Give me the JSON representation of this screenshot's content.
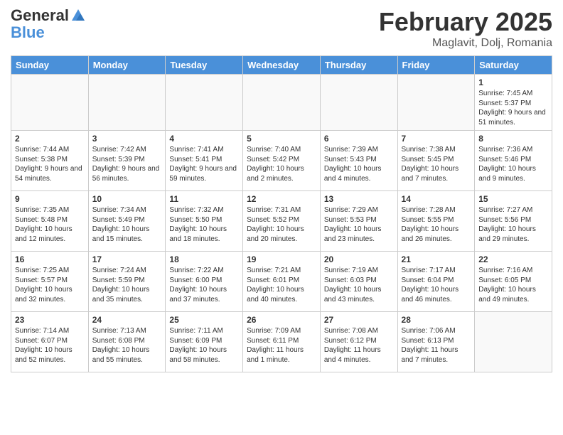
{
  "header": {
    "logo_general": "General",
    "logo_blue": "Blue",
    "month_title": "February 2025",
    "location": "Maglavit, Dolj, Romania"
  },
  "days_of_week": [
    "Sunday",
    "Monday",
    "Tuesday",
    "Wednesday",
    "Thursday",
    "Friday",
    "Saturday"
  ],
  "weeks": [
    [
      {
        "day": "",
        "info": ""
      },
      {
        "day": "",
        "info": ""
      },
      {
        "day": "",
        "info": ""
      },
      {
        "day": "",
        "info": ""
      },
      {
        "day": "",
        "info": ""
      },
      {
        "day": "",
        "info": ""
      },
      {
        "day": "1",
        "info": "Sunrise: 7:45 AM\nSunset: 5:37 PM\nDaylight: 9 hours and 51 minutes."
      }
    ],
    [
      {
        "day": "2",
        "info": "Sunrise: 7:44 AM\nSunset: 5:38 PM\nDaylight: 9 hours and 54 minutes."
      },
      {
        "day": "3",
        "info": "Sunrise: 7:42 AM\nSunset: 5:39 PM\nDaylight: 9 hours and 56 minutes."
      },
      {
        "day": "4",
        "info": "Sunrise: 7:41 AM\nSunset: 5:41 PM\nDaylight: 9 hours and 59 minutes."
      },
      {
        "day": "5",
        "info": "Sunrise: 7:40 AM\nSunset: 5:42 PM\nDaylight: 10 hours and 2 minutes."
      },
      {
        "day": "6",
        "info": "Sunrise: 7:39 AM\nSunset: 5:43 PM\nDaylight: 10 hours and 4 minutes."
      },
      {
        "day": "7",
        "info": "Sunrise: 7:38 AM\nSunset: 5:45 PM\nDaylight: 10 hours and 7 minutes."
      },
      {
        "day": "8",
        "info": "Sunrise: 7:36 AM\nSunset: 5:46 PM\nDaylight: 10 hours and 9 minutes."
      }
    ],
    [
      {
        "day": "9",
        "info": "Sunrise: 7:35 AM\nSunset: 5:48 PM\nDaylight: 10 hours and 12 minutes."
      },
      {
        "day": "10",
        "info": "Sunrise: 7:34 AM\nSunset: 5:49 PM\nDaylight: 10 hours and 15 minutes."
      },
      {
        "day": "11",
        "info": "Sunrise: 7:32 AM\nSunset: 5:50 PM\nDaylight: 10 hours and 18 minutes."
      },
      {
        "day": "12",
        "info": "Sunrise: 7:31 AM\nSunset: 5:52 PM\nDaylight: 10 hours and 20 minutes."
      },
      {
        "day": "13",
        "info": "Sunrise: 7:29 AM\nSunset: 5:53 PM\nDaylight: 10 hours and 23 minutes."
      },
      {
        "day": "14",
        "info": "Sunrise: 7:28 AM\nSunset: 5:55 PM\nDaylight: 10 hours and 26 minutes."
      },
      {
        "day": "15",
        "info": "Sunrise: 7:27 AM\nSunset: 5:56 PM\nDaylight: 10 hours and 29 minutes."
      }
    ],
    [
      {
        "day": "16",
        "info": "Sunrise: 7:25 AM\nSunset: 5:57 PM\nDaylight: 10 hours and 32 minutes."
      },
      {
        "day": "17",
        "info": "Sunrise: 7:24 AM\nSunset: 5:59 PM\nDaylight: 10 hours and 35 minutes."
      },
      {
        "day": "18",
        "info": "Sunrise: 7:22 AM\nSunset: 6:00 PM\nDaylight: 10 hours and 37 minutes."
      },
      {
        "day": "19",
        "info": "Sunrise: 7:21 AM\nSunset: 6:01 PM\nDaylight: 10 hours and 40 minutes."
      },
      {
        "day": "20",
        "info": "Sunrise: 7:19 AM\nSunset: 6:03 PM\nDaylight: 10 hours and 43 minutes."
      },
      {
        "day": "21",
        "info": "Sunrise: 7:17 AM\nSunset: 6:04 PM\nDaylight: 10 hours and 46 minutes."
      },
      {
        "day": "22",
        "info": "Sunrise: 7:16 AM\nSunset: 6:05 PM\nDaylight: 10 hours and 49 minutes."
      }
    ],
    [
      {
        "day": "23",
        "info": "Sunrise: 7:14 AM\nSunset: 6:07 PM\nDaylight: 10 hours and 52 minutes."
      },
      {
        "day": "24",
        "info": "Sunrise: 7:13 AM\nSunset: 6:08 PM\nDaylight: 10 hours and 55 minutes."
      },
      {
        "day": "25",
        "info": "Sunrise: 7:11 AM\nSunset: 6:09 PM\nDaylight: 10 hours and 58 minutes."
      },
      {
        "day": "26",
        "info": "Sunrise: 7:09 AM\nSunset: 6:11 PM\nDaylight: 11 hours and 1 minute."
      },
      {
        "day": "27",
        "info": "Sunrise: 7:08 AM\nSunset: 6:12 PM\nDaylight: 11 hours and 4 minutes."
      },
      {
        "day": "28",
        "info": "Sunrise: 7:06 AM\nSunset: 6:13 PM\nDaylight: 11 hours and 7 minutes."
      },
      {
        "day": "",
        "info": ""
      }
    ]
  ]
}
